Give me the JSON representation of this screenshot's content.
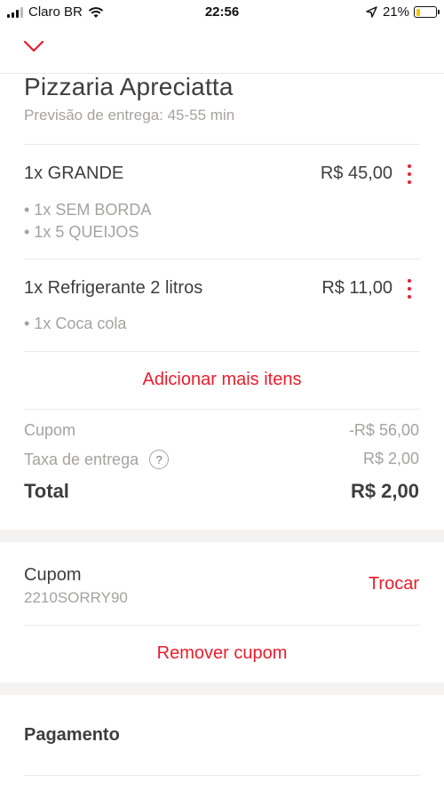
{
  "status_bar": {
    "carrier": "Claro BR",
    "time": "22:56",
    "battery": "21%",
    "battery_level": 0.21
  },
  "header": {
    "close_icon": "chevron-down-icon"
  },
  "restaurant": {
    "name": "Pizzaria Apreciatta",
    "delivery_estimate": "Previsão de entrega: 45-55 min"
  },
  "items": [
    {
      "title": "1x GRANDE",
      "price": "R$  45,00",
      "options": [
        "• 1x SEM BORDA",
        "• 1x 5 QUEIJOS"
      ]
    },
    {
      "title": "1x Refrigerante 2 litros",
      "price": "R$  11,00",
      "options": [
        "• 1x Coca cola"
      ]
    }
  ],
  "add_more_label": "Adicionar mais itens",
  "summary": {
    "coupon_label": "Cupom",
    "coupon_value": "-R$  56,00",
    "delivery_fee_label": "Taxa de entrega",
    "delivery_fee_help": "?",
    "delivery_fee_value": "R$  2,00",
    "total_label": "Total",
    "total_value": "R$  2,00"
  },
  "coupon_section": {
    "label": "Cupom",
    "code": "2210SORRY90",
    "swap_label": "Trocar",
    "remove_label": "Remover cupom"
  },
  "payment": {
    "title": "Pagamento"
  },
  "colors": {
    "accent": "#ea1d2c",
    "text": "#3f3e3e",
    "muted": "#a6a29f",
    "separator": "#f5f3f2"
  }
}
